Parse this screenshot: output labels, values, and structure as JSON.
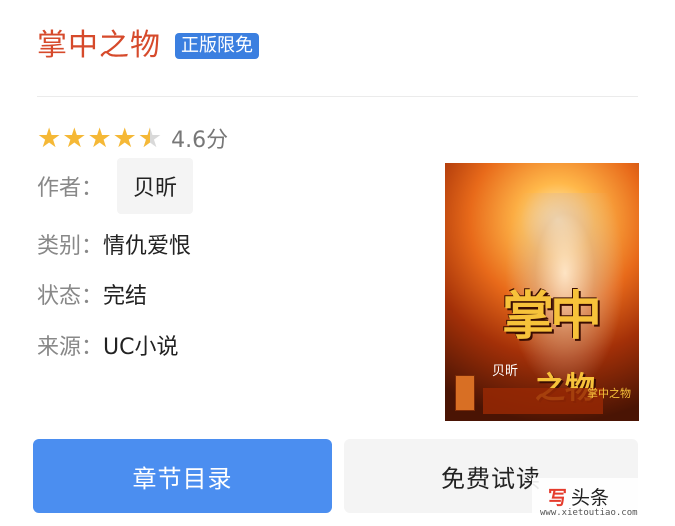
{
  "book": {
    "title": "掌中之物",
    "badge": "正版限免",
    "rating": 4.6,
    "rating_text": "4.6分",
    "author_label": "作者：",
    "author": "贝昕",
    "category_label": "类别：",
    "category": "情仇爱恨",
    "status_label": "状态：",
    "status": "完结",
    "source_label": "来源：",
    "source": "UC小说"
  },
  "cover": {
    "title_main": "掌中",
    "title_sub": "之物",
    "author": "贝昕",
    "corner_text": "掌中之物"
  },
  "actions": {
    "read_label": "章节目录",
    "trial_label": "免费试读"
  },
  "watermark": {
    "logo_mark": "写",
    "logo_text": "头条",
    "url": "www.xietoutiao.com"
  },
  "colors": {
    "title": "#d64a2b",
    "badge_bg": "#3b7fe0",
    "primary_button": "#4b8ef0",
    "star": "#f5b836"
  }
}
